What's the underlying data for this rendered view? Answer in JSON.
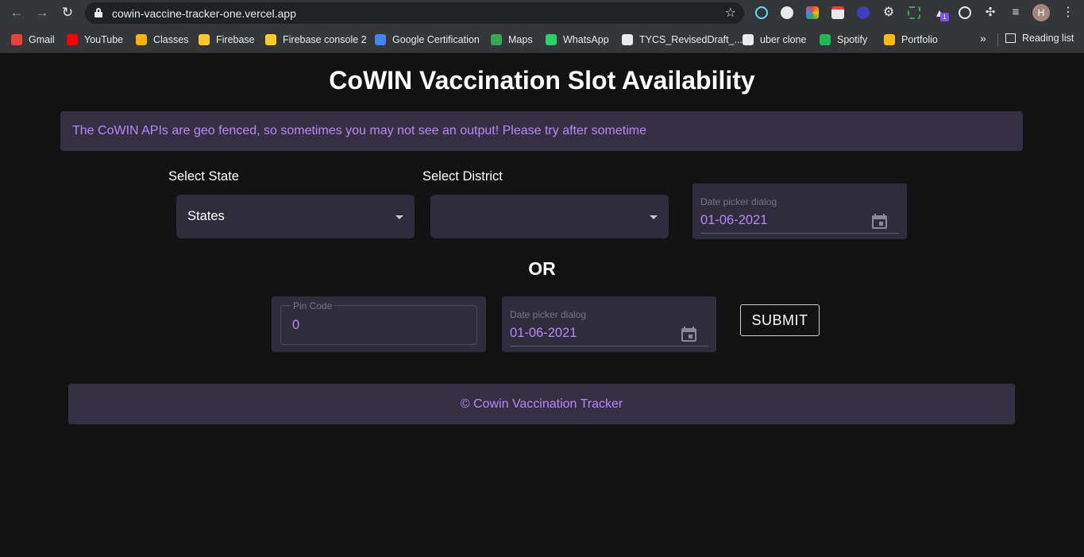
{
  "browser": {
    "url": "cowin-vaccine-tracker-one.vercel.app",
    "profile_initial": "H",
    "extension_badge": "1",
    "bookmarks": [
      {
        "label": "Gmail",
        "icon": "gmail-icon",
        "color": "#ea4335"
      },
      {
        "label": "YouTube",
        "icon": "youtube-icon",
        "color": "#ff0000"
      },
      {
        "label": "Classes",
        "icon": "google-classroom-icon",
        "color": "#f4b400"
      },
      {
        "label": "Firebase",
        "icon": "firebase-icon",
        "color": "#ffca28"
      },
      {
        "label": "Firebase console 2",
        "icon": "firebase-icon",
        "color": "#ffca28"
      },
      {
        "label": "Google Certification",
        "icon": "google-icon",
        "color": "#4285f4"
      },
      {
        "label": "Maps",
        "icon": "google-maps-icon",
        "color": "#34a853"
      },
      {
        "label": "WhatsApp",
        "icon": "whatsapp-icon",
        "color": "#25d366"
      },
      {
        "label": "TYCS_RevisedDraft_...",
        "icon": "globe-icon",
        "color": "#e8eaed"
      },
      {
        "label": "uber clone",
        "icon": "wordpress-icon",
        "color": "#e8eaed"
      },
      {
        "label": "Spotify",
        "icon": "spotify-icon",
        "color": "#1db954"
      },
      {
        "label": "Portfolio",
        "icon": "portfolio-icon",
        "color": "#fbbc04"
      }
    ],
    "more_bookmarks": "»",
    "reading_list": "Reading list"
  },
  "page": {
    "title": "CoWIN Vaccination Slot Availability",
    "alert": "The CoWIN APIs are geo fenced, so sometimes you may not see an output! Please try after sometime",
    "state_label": "Select State",
    "state_value": "States",
    "district_label": "Select District",
    "district_value": "",
    "date_label": "Date picker dialog",
    "date_value": "01-06-2021",
    "or_text": "OR",
    "pin_label": "Pin Code",
    "pin_value": "0",
    "date2_label": "Date picker dialog",
    "date2_value": "01-06-2021",
    "submit_label": "SUBMIT",
    "footer": "© Cowin Vaccination Tracker"
  },
  "colors": {
    "accent": "#bb86fc",
    "background": "#121212",
    "surface": "#2f2d3c",
    "alert_bg": "#352f44"
  }
}
